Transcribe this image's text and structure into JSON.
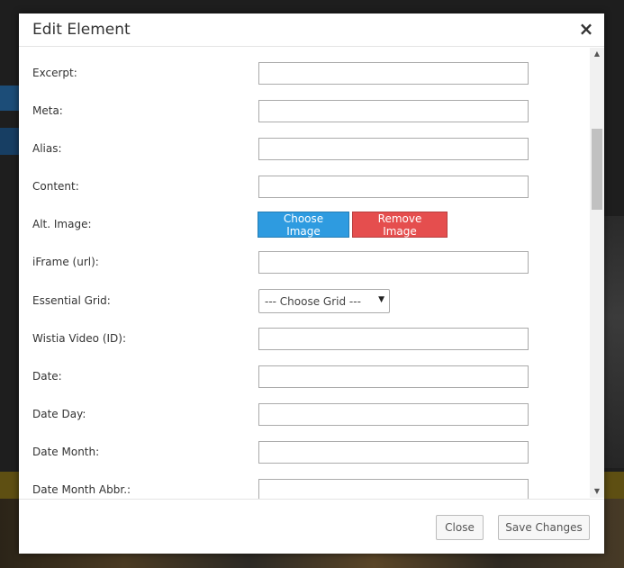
{
  "dialog": {
    "title": "Edit Element",
    "close_icon": "close-icon"
  },
  "fields": [
    {
      "label": "Excerpt:",
      "type": "text",
      "value": ""
    },
    {
      "label": "Meta:",
      "type": "text",
      "value": ""
    },
    {
      "label": "Alias:",
      "type": "text",
      "value": ""
    },
    {
      "label": "Content:",
      "type": "text",
      "value": ""
    },
    {
      "label": "Alt. Image:",
      "type": "buttons",
      "choose_label": "Choose Image",
      "remove_label": "Remove Image"
    },
    {
      "label": "iFrame (url):",
      "type": "text",
      "value": ""
    },
    {
      "label": "Essential Grid:",
      "type": "select",
      "selected": "--- Choose Grid ---"
    },
    {
      "label": "Wistia Video (ID):",
      "type": "text",
      "value": ""
    },
    {
      "label": "Date:",
      "type": "text",
      "value": ""
    },
    {
      "label": "Date Day:",
      "type": "text",
      "value": ""
    },
    {
      "label": "Date Month:",
      "type": "text",
      "value": ""
    },
    {
      "label": "Date Month Abbr.:",
      "type": "text",
      "value": ""
    }
  ],
  "footer": {
    "close_label": "Close",
    "save_label": "Save Changes"
  },
  "colors": {
    "choose_button": "#2e9be0",
    "remove_button": "#e54e4e"
  }
}
